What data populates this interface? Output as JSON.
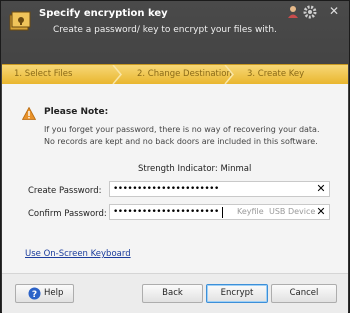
{
  "header": {
    "title": "Specify encryption key",
    "subtitle": "Create a password/ key to encrypt your files with."
  },
  "steps": [
    {
      "label": "1. Select Files"
    },
    {
      "label": "2. Change Destination"
    },
    {
      "label": "3. Create Key"
    }
  ],
  "note": {
    "title": "Please Note:",
    "line1": "If you forget your password, there is no way of recovering your data.",
    "line2": "No records are kept and no back doors are included in this software."
  },
  "strength": "Strength Indicator: Minmal",
  "form": {
    "create_label": "Create Password:",
    "create_value": "••••••••••••••••••••••",
    "confirm_label": "Confirm Password:",
    "confirm_value": "••••••••••••••••••••••",
    "keyfile_label": "Keyfile",
    "usb_label": "USB Device"
  },
  "osk_link": "Use On-Screen Keyboard",
  "buttons": {
    "help": "Help",
    "back": "Back",
    "encrypt": "Encrypt",
    "cancel": "Cancel"
  },
  "colors": {
    "accent": "#e9b62e",
    "link": "#1a3c9c",
    "warning": "#e8922a"
  },
  "icons": {
    "app": "lock-safe-icon",
    "user": "user-icon",
    "settings": "gear-icon",
    "close": "close-icon",
    "warning": "warning-icon",
    "help": "help-icon"
  }
}
